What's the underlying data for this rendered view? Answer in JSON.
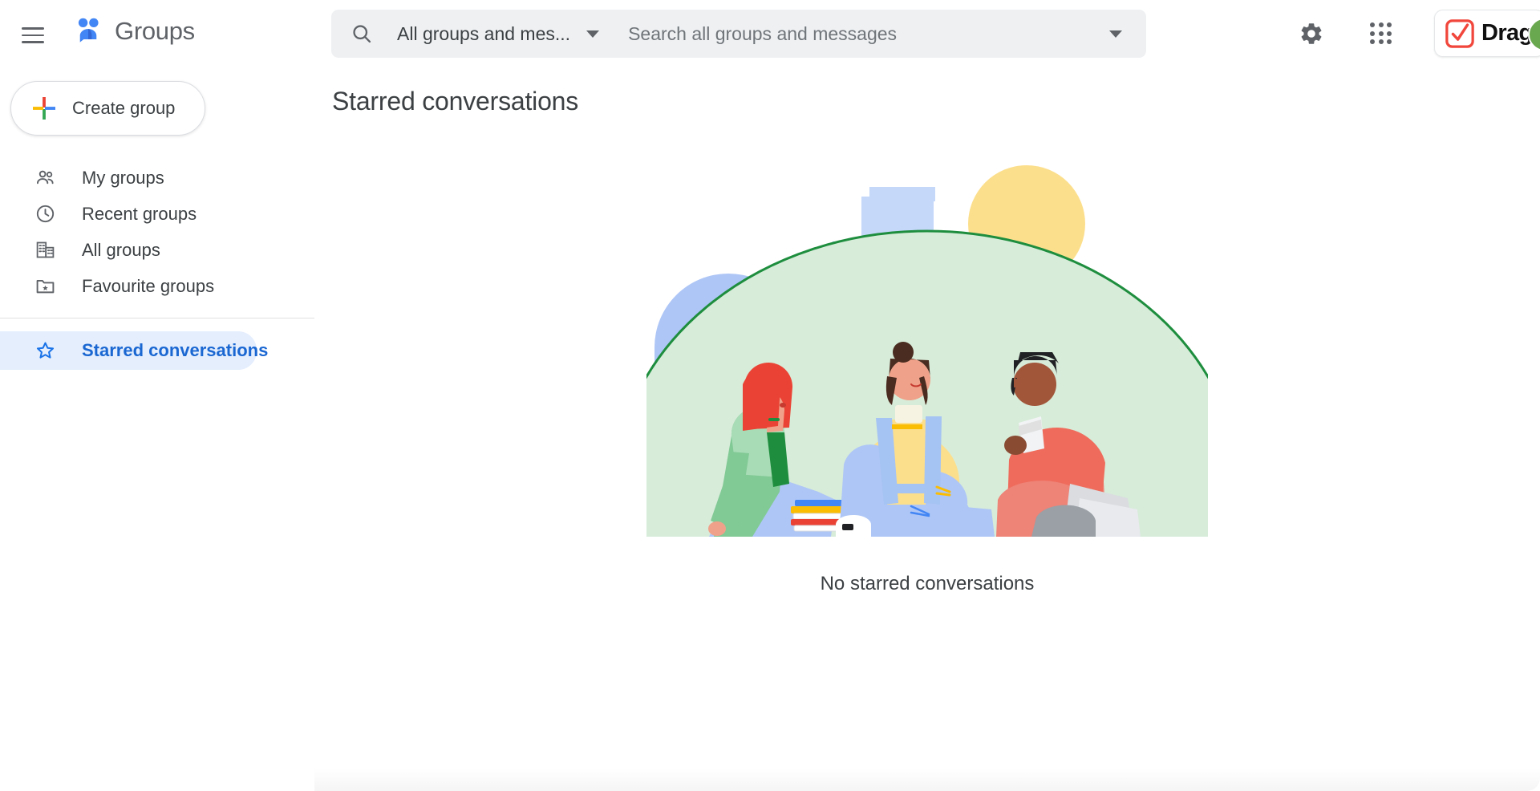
{
  "app": {
    "name": "Groups",
    "logo_icon": "groups-people-icon"
  },
  "topbar": {
    "menu_icon": "hamburger-menu-icon",
    "settings_icon": "gear-icon",
    "apps_icon": "apps-grid-icon",
    "extension": {
      "label": "Drag",
      "icon": "drag-checkbox-logo"
    },
    "avatar_icon": "user-avatar"
  },
  "search": {
    "icon": "search-icon",
    "scope_value": "All groups and mes...",
    "scope_caret_icon": "chevron-down-icon",
    "placeholder": "Search all groups and messages",
    "value": "",
    "options_caret_icon": "chevron-down-icon"
  },
  "sidebar": {
    "create": {
      "label": "Create group",
      "icon": "plus-icon"
    },
    "items": [
      {
        "label": "My groups",
        "icon": "people-icon",
        "selected": false
      },
      {
        "label": "Recent groups",
        "icon": "clock-icon",
        "selected": false
      },
      {
        "label": "All groups",
        "icon": "building-icon",
        "selected": false
      },
      {
        "label": "Favourite groups",
        "icon": "folder-star-icon",
        "selected": false
      },
      {
        "label": "Starred conversations",
        "icon": "star-outline-icon",
        "selected": true
      }
    ]
  },
  "main": {
    "title": "Starred conversations",
    "empty_message": "No starred conversations",
    "illustration_name": "people-sitting-on-hill-illustration"
  },
  "colors": {
    "accent_blue": "#1a73e8",
    "selected_bg": "#e4eefd",
    "text_primary": "#3c4043",
    "text_secondary": "#5f6368",
    "search_bg": "#eef0f2",
    "brand_red": "#ea4335",
    "brand_yellow": "#fbbc04",
    "brand_green": "#34a853",
    "illustration_green": "#d7ecd9",
    "illustration_blue": "#aec7f5",
    "illustration_yellow": "#fcdf8d"
  }
}
